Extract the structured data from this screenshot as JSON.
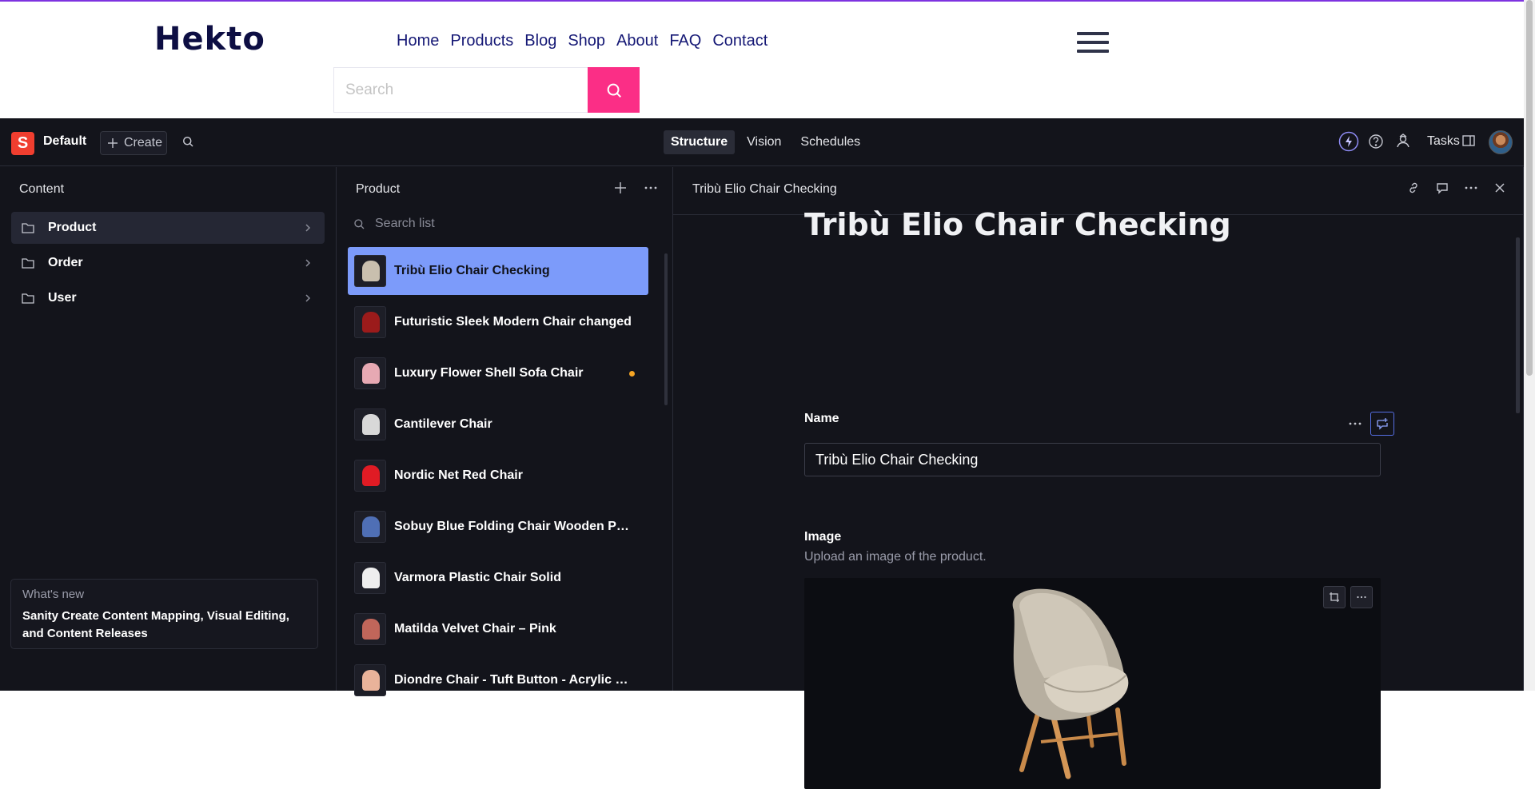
{
  "site": {
    "logo": "Hekto",
    "nav": [
      "Home",
      "Products",
      "Blog",
      "Shop",
      "About",
      "FAQ",
      "Contact"
    ],
    "search_placeholder": "Search",
    "brand_color": "#fb2e86"
  },
  "studio": {
    "logo_letter": "S",
    "workspace": "Default",
    "create_label": "Create",
    "tabs": [
      "Structure",
      "Vision",
      "Schedules"
    ],
    "active_tab": "Structure",
    "tasks_label": "Tasks",
    "icons": {
      "search": "search-icon",
      "lightning": "lightning-icon",
      "help": "help-icon",
      "presence": "presence-icon",
      "panel": "panel-icon"
    }
  },
  "content_pane": {
    "title": "Content",
    "items": [
      {
        "label": "Product",
        "active": true
      },
      {
        "label": "Order",
        "active": false
      },
      {
        "label": "User",
        "active": false
      }
    ],
    "whats_new": {
      "kicker": "What's new",
      "text": "Sanity Create Content Mapping, Visual Editing, and Content Releases"
    }
  },
  "product_pane": {
    "title": "Product",
    "search_placeholder": "Search list",
    "documents": [
      {
        "title": "Tribù Elio Chair Checking",
        "active": true,
        "unpublished": false,
        "thumb": "#c9bfae"
      },
      {
        "title": "Futuristic Sleek Modern Chair changed",
        "active": false,
        "unpublished": false,
        "thumb": "#9b1b1b"
      },
      {
        "title": "Luxury Flower Shell Sofa Chair",
        "active": false,
        "unpublished": true,
        "thumb": "#e7a9b3"
      },
      {
        "title": "Cantilever Chair",
        "active": false,
        "unpublished": false,
        "thumb": "#d8d8d8"
      },
      {
        "title": "Nordic Net Red Chair",
        "active": false,
        "unpublished": false,
        "thumb": "#e01b24"
      },
      {
        "title": "Sobuy Blue Folding Chair Wooden Pad...",
        "active": false,
        "unpublished": false,
        "thumb": "#4f6fb5"
      },
      {
        "title": "Varmora Plastic Chair Solid",
        "active": false,
        "unpublished": false,
        "thumb": "#eeeeee"
      },
      {
        "title": "Matilda Velvet Chair – Pink",
        "active": false,
        "unpublished": false,
        "thumb": "#c0665a"
      },
      {
        "title": "Diondre Chair - Tuft Button - Acrylic Le...",
        "active": false,
        "unpublished": false,
        "thumb": "#e9b39a"
      }
    ]
  },
  "document_pane": {
    "header_title": "Tribù Elio Chair Checking",
    "heading": "Tribù Elio Chair Checking",
    "name_label": "Name",
    "name_value": "Tribù Elio Chair Checking",
    "image_label": "Image",
    "image_desc": "Upload an image of the product."
  }
}
